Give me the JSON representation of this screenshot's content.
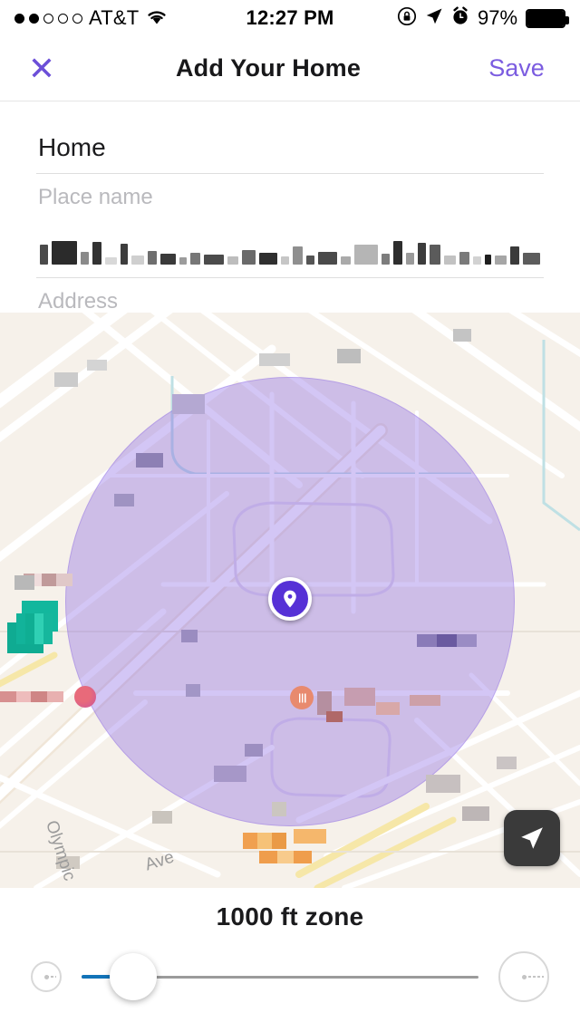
{
  "status_bar": {
    "signal_dots_filled": 2,
    "signal_dots_total": 5,
    "carrier": "AT&T",
    "wifi_icon": "wifi-icon",
    "time": "12:27 PM",
    "rotation_lock_icon": "rotation-lock-icon",
    "location_arrow_icon": "location-arrow-icon",
    "alarm_icon": "alarm-clock-icon",
    "battery_percent": "97%",
    "battery_icon": "battery-full-icon"
  },
  "nav_bar": {
    "close_label": "✕",
    "close_icon": "close-x-icon",
    "title": "Add Your Home",
    "save_label": "Save"
  },
  "form": {
    "place_name": {
      "value": "Home",
      "label": "Place name"
    },
    "address": {
      "value": "",
      "value_redacted": true,
      "label": "Address"
    }
  },
  "map": {
    "background_color": "#f6f1ea",
    "zone_fill_color": "#7e58e2",
    "pin_color": "#5631d6",
    "pin_icon": "map-pin-icon",
    "locate_button_icon": "navigation-arrow-icon",
    "street_labels": [
      "Olympic",
      "Ave"
    ],
    "poi_icons": [
      "park-icon",
      "restaurant-icon",
      "shop-icon"
    ]
  },
  "zone_control": {
    "title": "1000 ft zone",
    "min_icon": "small-radius-icon",
    "max_icon": "large-radius-icon",
    "slider_value_percent": 13,
    "slider_fill_color": "#1273b8"
  },
  "colors": {
    "accent_purple": "#7b5ce0",
    "close_purple": "#6c4fd8",
    "slider_blue": "#1273b8",
    "map_beige": "#f6f1ea"
  }
}
